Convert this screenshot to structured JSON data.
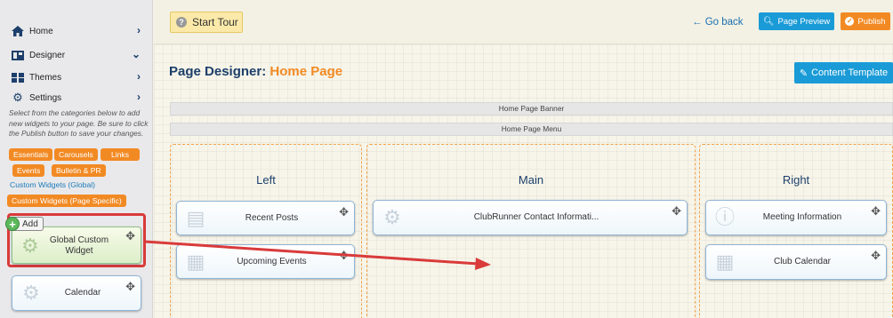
{
  "sidebar": {
    "nav": [
      {
        "label": "Home",
        "icon": "home-icon",
        "chevron": "›"
      },
      {
        "label": "Designer",
        "icon": "designer-icon",
        "chevron": "⌄"
      },
      {
        "label": "Themes",
        "icon": "themes-icon",
        "chevron": "›"
      },
      {
        "label": "Settings",
        "icon": "gear-icon",
        "chevron": "›"
      }
    ],
    "help_text": "Select from the categories below to add new widgets to your page. Be sure to click the Publish button to save your changes.",
    "categories": [
      "Essentials",
      "Carousels",
      "Links",
      "Events",
      "Bulletin & PR",
      "Custom Widgets (Global)",
      "Custom Widgets (Page Specific)"
    ],
    "add_tooltip": "Add",
    "widgets": [
      {
        "label": "Global Custom Widget",
        "icon": "gear-icon"
      },
      {
        "label": "Calendar",
        "icon": "gear-icon"
      }
    ]
  },
  "topbar": {
    "tour_label": "Start Tour",
    "goback_label": "← Go back",
    "preview_label": "Page Preview",
    "publish_label": "Publish"
  },
  "page": {
    "title_prefix": "Page Designer: ",
    "title_accent": "Home Page",
    "template_label": "Content Template",
    "banner_label": "Home Page Banner",
    "menu_label": "Home Page Menu"
  },
  "columns": {
    "left": {
      "title": "Left",
      "widgets": [
        "Recent Posts",
        "Upcoming Events"
      ]
    },
    "main": {
      "title": "Main",
      "widgets": [
        "ClubRunner Contact Informati..."
      ]
    },
    "right": {
      "title": "Right",
      "widgets": [
        "Meeting Information",
        "Club Calendar"
      ]
    }
  },
  "colors": {
    "accent": "#f28a24",
    "primary": "#1a9bd7",
    "highlight": "#d93a3a"
  }
}
